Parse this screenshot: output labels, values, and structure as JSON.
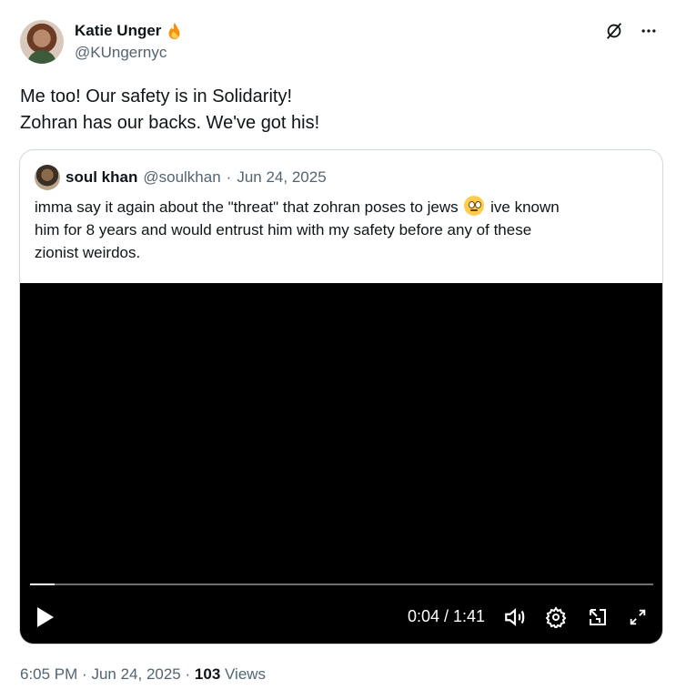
{
  "author": {
    "name": "Katie Unger",
    "badge_icon": "fire-emoji",
    "handle": "@KUngernyc"
  },
  "top_actions": [
    "grok-icon",
    "more-icon"
  ],
  "tweet": {
    "lines": [
      "Me too! Our safety is in Solidarity!",
      "Zohran has our backs. We've got his!"
    ]
  },
  "quote": {
    "name": "soul khan",
    "handle": "@soulkhan",
    "separator": "·",
    "date": "Jun 24, 2025",
    "text_line1_a": "imma say it again about the \"threat\" that zohran poses to jews",
    "text_line1_emoji": "face-with-rolling-eyes",
    "text_line1_b": "ive known",
    "text_line2": "him for 8 years and would entrust him with my safety before any of these",
    "text_line3": "zionist weirdos."
  },
  "video": {
    "current_time": "0:04",
    "duration": "1:41",
    "time_display": "0:04 / 1:41",
    "progress_fraction": 0.04,
    "controls": [
      "play-icon",
      "volume-icon",
      "settings-icon",
      "pip-icon",
      "fullscreen-icon"
    ]
  },
  "footer": {
    "time": "6:05 PM",
    "sep1": "·",
    "date": "Jun 24, 2025",
    "sep2": "·",
    "views_count": "103",
    "views_label": "Views"
  },
  "colors": {
    "text": "#0f1419",
    "secondary": "#536471",
    "border": "#cfd9de",
    "video_bg": "#000000"
  }
}
